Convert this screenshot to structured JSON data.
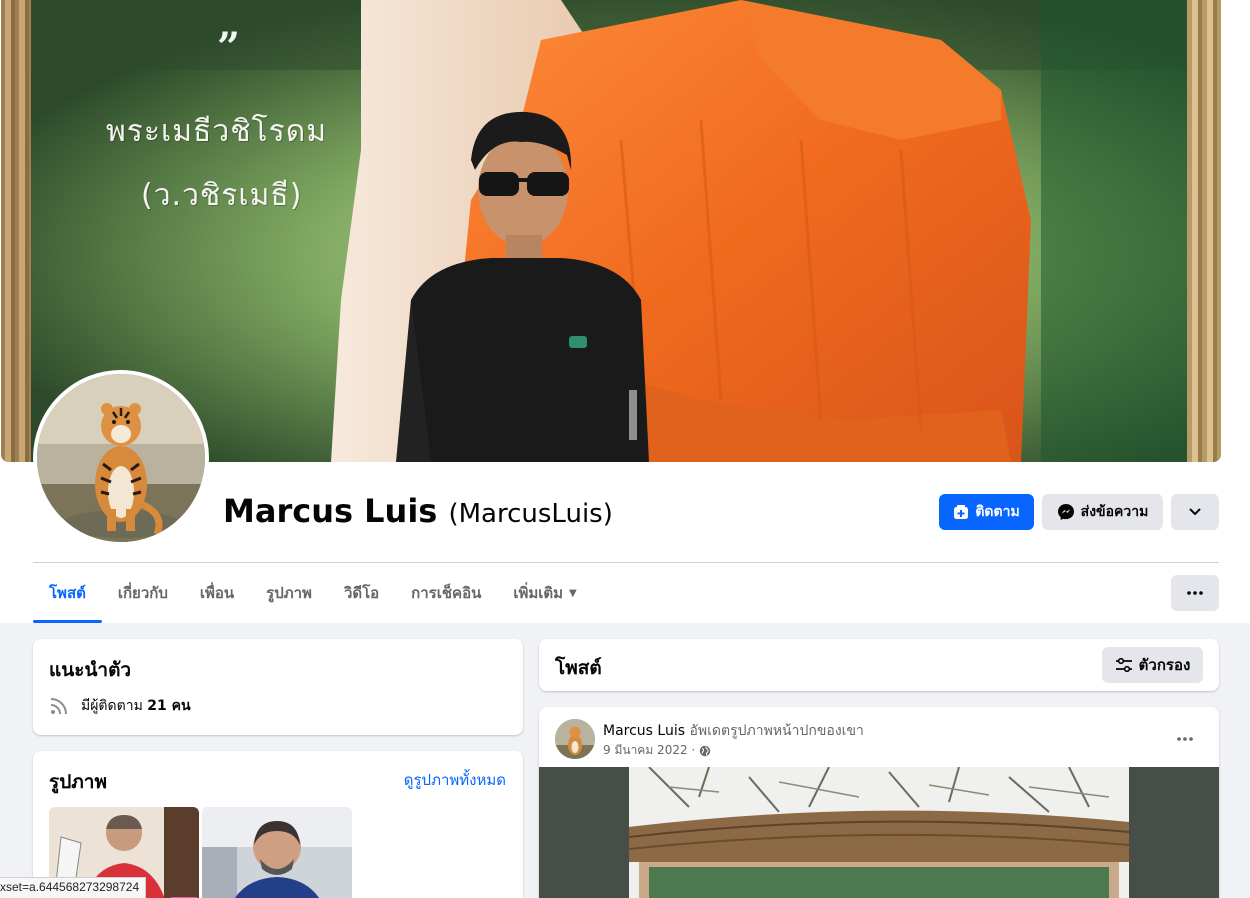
{
  "cover": {
    "quote_mark": "”",
    "text_line1": "พระเมธีวชิโรดม",
    "text_line2": "(ว.วชิรเมธี)"
  },
  "profile": {
    "name": "Marcus Luis",
    "handle": "(MarcusLuis)",
    "follow_label": "ติดตาม",
    "message_label": "ส่งข้อความ"
  },
  "tabs": [
    {
      "label": "โพสต์",
      "active": true
    },
    {
      "label": "เกี่ยวกับ"
    },
    {
      "label": "เพื่อน"
    },
    {
      "label": "รูปภาพ"
    },
    {
      "label": "วิดีโอ"
    },
    {
      "label": "การเช็คอิน"
    },
    {
      "label": "เพิ่มเติม"
    }
  ],
  "intro": {
    "title": "แนะนำตัว",
    "followers_prefix": "มีผู้ติดตาม",
    "followers_count": "21 คน"
  },
  "photos": {
    "title": "รูปภาพ",
    "see_all": "ดูรูปภาพทั้งหมด"
  },
  "posts": {
    "title": "โพสต์",
    "filter_label": "ตัวกรอง"
  },
  "post": {
    "author": "Marcus Luis",
    "action": "อัพเดตรูปภาพหน้าปกของเขา",
    "date": "9 มีนาคม 2022 ·"
  },
  "status_bar": {
    "url": "xset=a.644568273298724"
  },
  "colors": {
    "accent": "#0866ff",
    "button_gray": "#e4e6eb",
    "page_bg": "#f0f2f5"
  }
}
